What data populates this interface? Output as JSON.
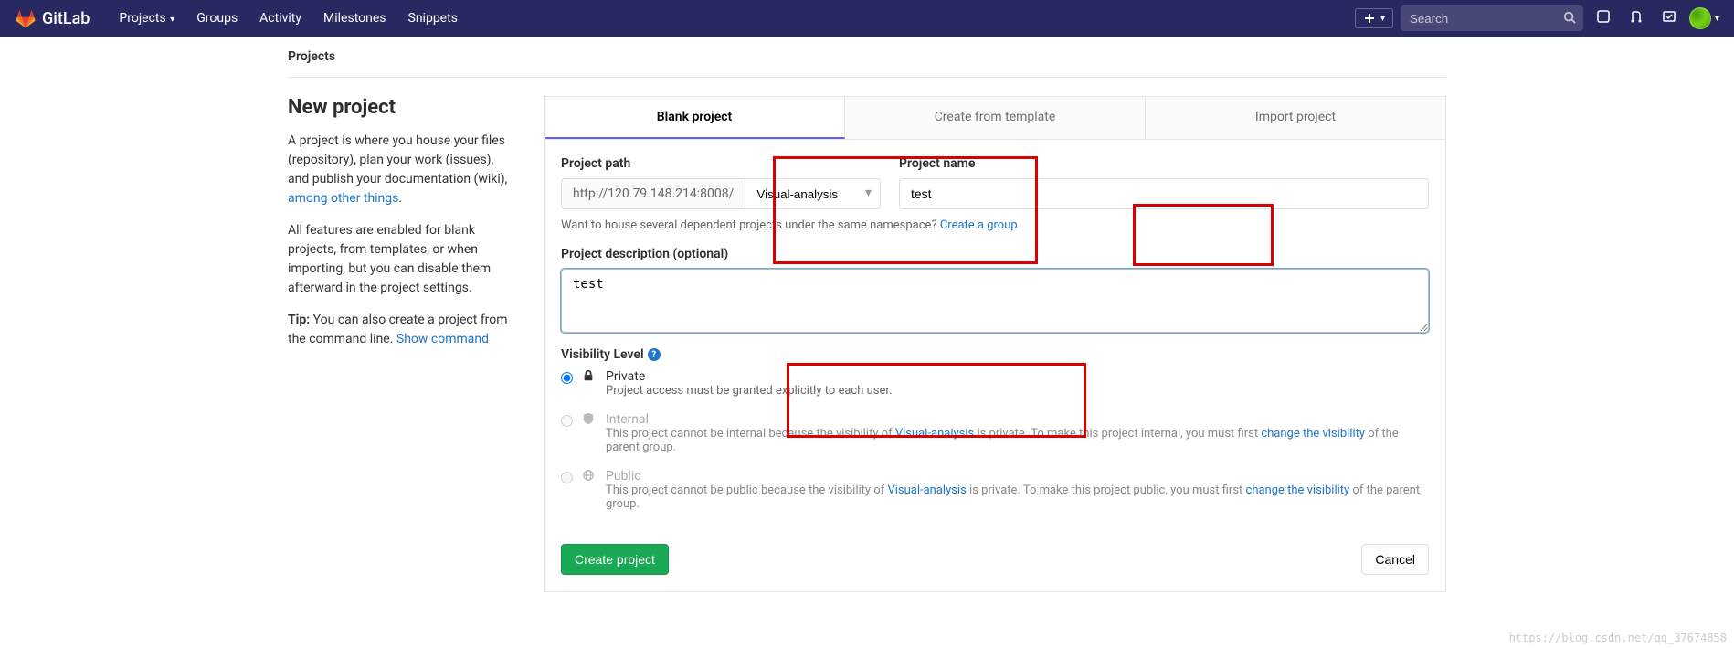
{
  "navbar": {
    "brand": "GitLab",
    "links": [
      "Projects",
      "Groups",
      "Activity",
      "Milestones",
      "Snippets"
    ],
    "search_placeholder": "Search"
  },
  "breadcrumb": "Projects",
  "sidebar": {
    "heading": "New project",
    "intro_before": "A project is where you house your files (repository), plan your work (issues), and publish your documentation (wiki), ",
    "intro_link": "among other things",
    "intro_after": ".",
    "features": "All features are enabled for blank projects, from templates, or when importing, but you can disable them afterward in the project settings.",
    "tip_label": "Tip:",
    "tip_text": " You can also create a project from the command line. ",
    "tip_link": "Show command"
  },
  "tabs": {
    "blank": "Blank project",
    "template": "Create from template",
    "import": "Import project"
  },
  "form": {
    "path_label": "Project path",
    "path_prefix": "http://120.79.148.214:8008/",
    "path_namespace": "Visual-analysis",
    "name_label": "Project name",
    "name_value": "test",
    "namespace_hint": "Want to house several dependent projects under the same namespace? ",
    "namespace_hint_link": "Create a group",
    "desc_label": "Project description (optional)",
    "desc_value": "test",
    "visibility_label": "Visibility Level",
    "visibility": {
      "private": {
        "name": "Private",
        "desc": "Project access must be granted explicitly to each user."
      },
      "internal": {
        "name": "Internal",
        "desc_before": "This project cannot be internal because the visibility of ",
        "desc_link1": "Visual-analysis",
        "desc_mid": " is private. To make this project internal, you must first ",
        "desc_link2": "change the visibility",
        "desc_after": " of the parent group."
      },
      "public": {
        "name": "Public",
        "desc_before": "This project cannot be public because the visibility of ",
        "desc_link1": "Visual-analysis",
        "desc_mid": " is private. To make this project public, you must first ",
        "desc_link2": "change the visibility",
        "desc_after": " of the parent group."
      }
    },
    "create_btn": "Create project",
    "cancel_btn": "Cancel"
  },
  "watermark": "https://blog.csdn.net/qq_37674858"
}
